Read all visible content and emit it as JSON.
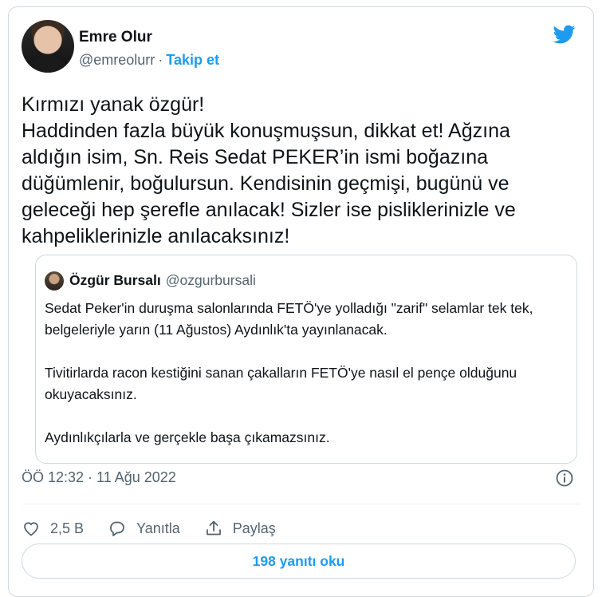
{
  "author": {
    "name": "Emre Olur",
    "handle": "@emreolurr",
    "separator": "·",
    "follow_label": "Takip et"
  },
  "tweet": {
    "text": "Kırmızı yanak özgür!\nHaddinden fazla büyük konuşmuşsun, dikkat et! Ağzına aldığın isim, Sn. Reis Sedat PEKER’in ismi boğazına düğümlenir, boğulursun. Kendisinin geçmişi, bugünü ve geleceği hep şerefle anılacak! Sizler ise pisliklerinizle ve kahpeliklerinizle anılacaksınız!"
  },
  "quoted": {
    "name": "Özgür Bursalı",
    "handle": "@ozgurbursali",
    "paragraphs": [
      "Sedat Peker'in duruşma salonlarında FETÖ'ye yolladığı \"zarif\" selamlar tek tek, belgeleriyle yarın (11 Ağustos) Aydınlık'ta yayınlanacak.",
      "Tivitirlarda racon kestiğini sanan çakalların FETÖ'ye nasıl el pençe olduğunu okuyacaksınız.",
      "Aydınlıkçılarla ve gerçekle başa çıkamazsınız."
    ]
  },
  "meta": {
    "timestamp": "ÖÖ 12:32 · 11 Ağu 2022"
  },
  "actions": {
    "like_count": "2,5 B",
    "reply_label": "Yanıtla",
    "share_label": "Paylaş"
  },
  "replies_button": "198 yanıtı oku",
  "colors": {
    "accent": "#1d9bf0",
    "muted": "#536471",
    "border": "#cfd9de"
  },
  "icons": [
    "twitter-bird-icon",
    "info-icon",
    "heart-icon",
    "speech-bubble-icon",
    "share-icon"
  ]
}
